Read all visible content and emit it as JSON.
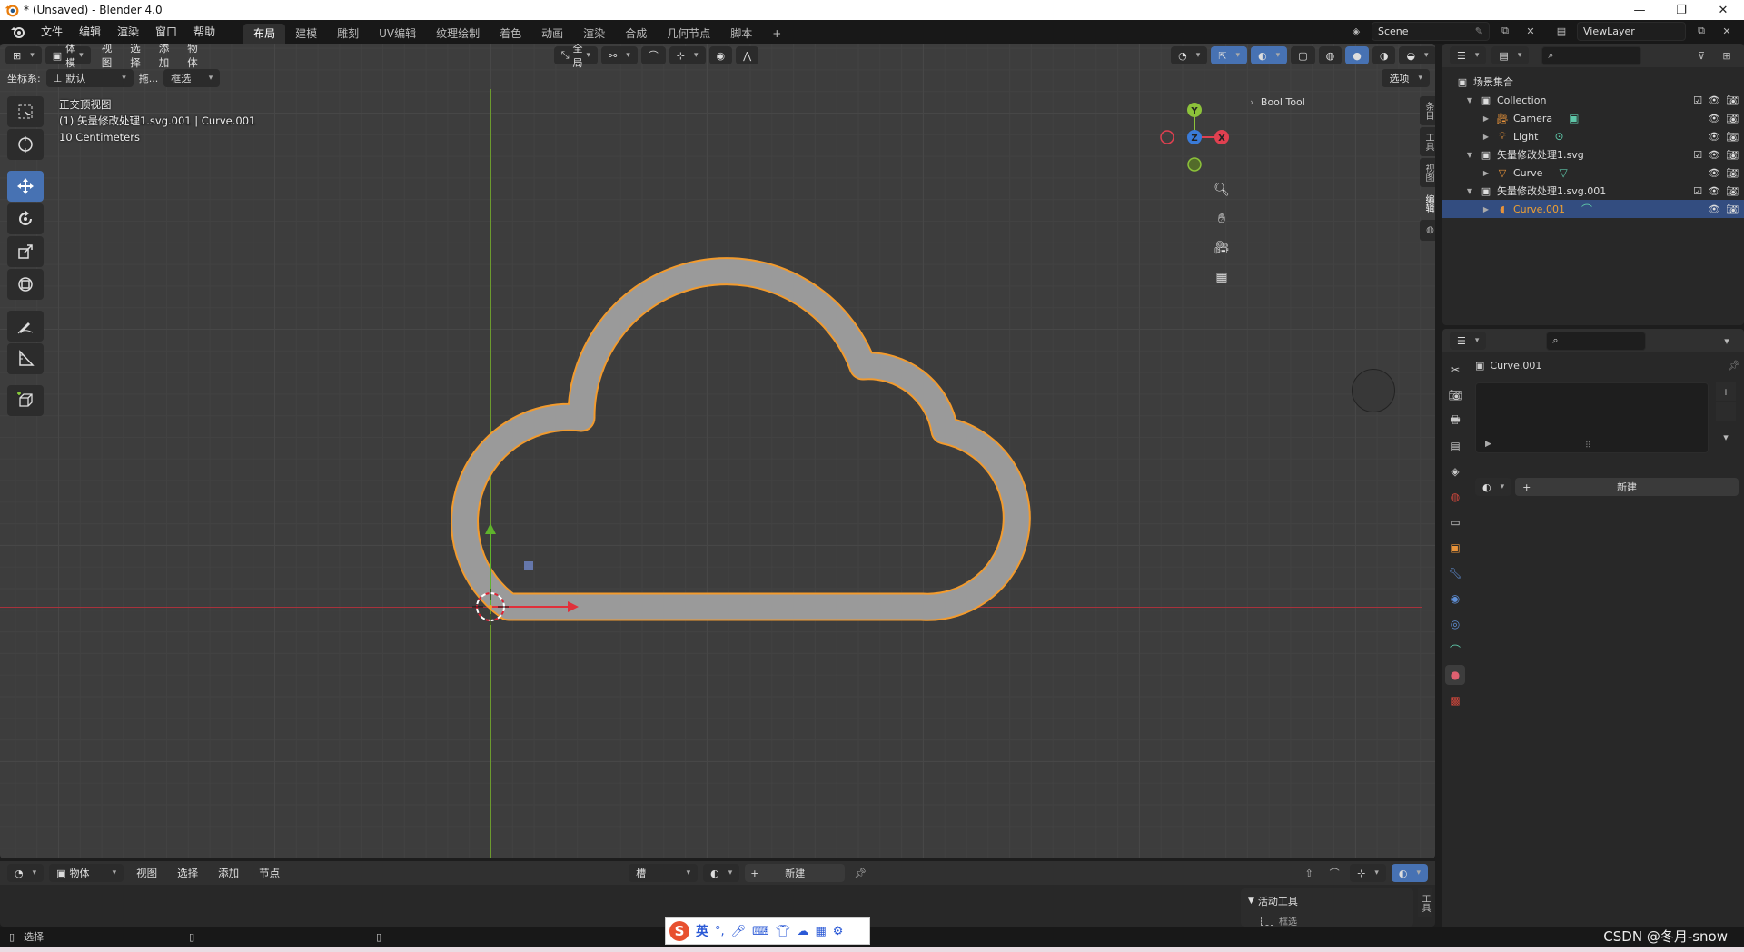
{
  "window": {
    "title": "* (Unsaved) - Blender 4.0",
    "controls": [
      "—",
      "❐",
      "✕"
    ]
  },
  "menu": [
    "文件",
    "编辑",
    "渲染",
    "窗口",
    "帮助"
  ],
  "workspaces": [
    "布局",
    "建模",
    "雕刻",
    "UV编辑",
    "纹理绘制",
    "着色",
    "动画",
    "渲染",
    "合成",
    "几何节点",
    "脚本"
  ],
  "workspace_add": "+",
  "scene": {
    "name": "Scene",
    "view_layer": "ViewLayer"
  },
  "viewport": {
    "mode": "物体模式",
    "menus": [
      "视图",
      "选择",
      "添加",
      "物体"
    ],
    "transform_orientation": "全局",
    "coord_label": "坐标系:",
    "coord_value": "默认",
    "drag_label": "拖...",
    "select_mode": "框选",
    "options": "选项",
    "overlay_info": {
      "view_name": "正交顶视图",
      "object_info": "(1) 矢量修改处理1.svg.001 | Curve.001",
      "scale": "10 Centimeters"
    },
    "gizmo": {
      "x": "X",
      "y": "Y",
      "z": "Z"
    },
    "bool_tool": "Bool Tool",
    "npanel_tabs": [
      "条目",
      "工具",
      "视图",
      "编辑"
    ]
  },
  "outliner": {
    "root": "场景集合",
    "rows": [
      {
        "label": "Collection",
        "level": 1,
        "type": "collection",
        "expanded": true
      },
      {
        "label": "Camera",
        "level": 2,
        "type": "camera"
      },
      {
        "label": "Light",
        "level": 2,
        "type": "light"
      },
      {
        "label": "矢量修改处理1.svg",
        "level": 1,
        "type": "collection",
        "expanded": true
      },
      {
        "label": "Curve",
        "level": 2,
        "type": "curve"
      },
      {
        "label": "矢量修改处理1.svg.001",
        "level": 1,
        "type": "collection",
        "expanded": true
      },
      {
        "label": "Curve.001",
        "level": 2,
        "type": "curve",
        "selected": true
      }
    ]
  },
  "properties": {
    "object_name": "Curve.001",
    "new_button": "新建"
  },
  "shader_editor": {
    "type": "物体",
    "menus": [
      "视图",
      "选择",
      "添加",
      "节点"
    ],
    "slot": "槽",
    "new_button": "新建"
  },
  "active_tool": {
    "title": "活动工具",
    "tool": "框选"
  },
  "statusbar": {
    "select": "选择"
  },
  "ime": {
    "logo": "S",
    "lang": "英",
    "punct": "°,"
  },
  "watermark": "CSDN @冬月-snow",
  "colors": {
    "accent_blue": "#4772b3",
    "selection_orange": "#f29b2e",
    "axis_red": "#a8323c",
    "axis_green": "#6c9a2e",
    "cloud_fill": "#9a9a9a"
  }
}
